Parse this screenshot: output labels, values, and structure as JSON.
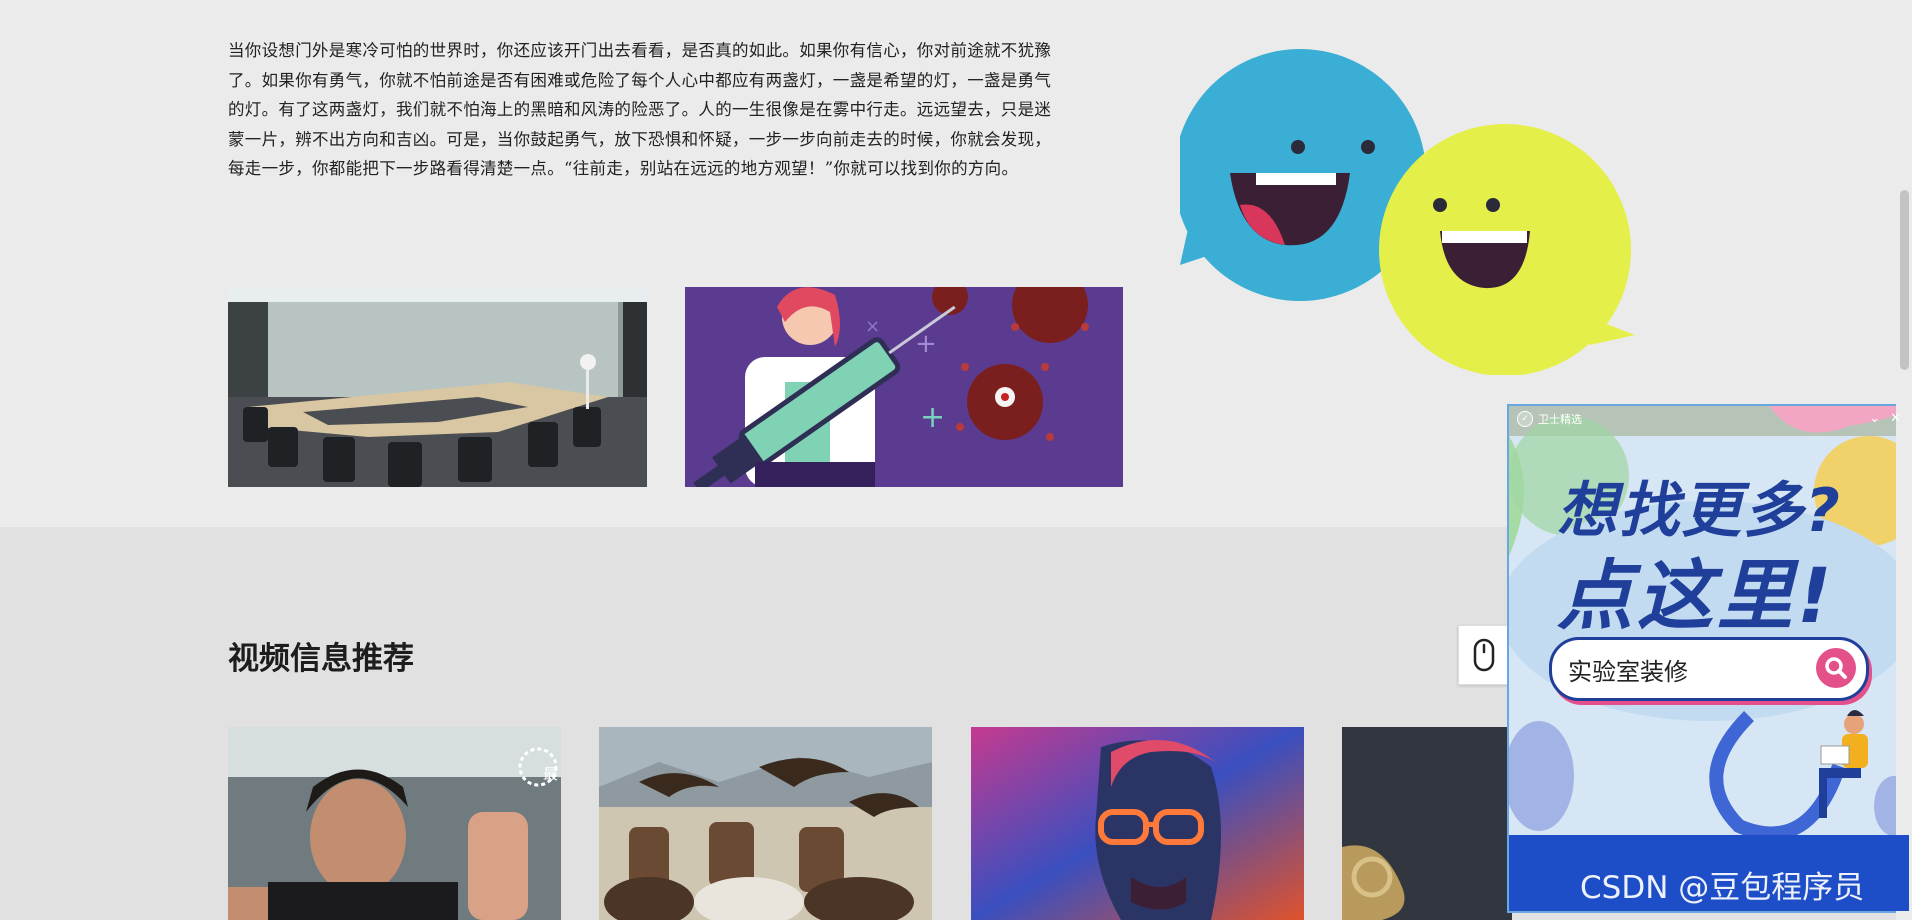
{
  "article": {
    "paragraph": "当你设想门外是寒冷可怕的世界时，你还应该开门出去看看，是否真的如此。如果你有信心，你对前途就不犹豫了。如果你有勇气，你就不怕前途是否有困难或危险了每个人心中都应有两盏灯，一盏是希望的灯，一盏是勇气的灯。有了这两盏灯，我们就不怕海上的黑暗和风涛的险恶了。人的一生很像是在雾中行走。远远望去，只是迷蒙一片，辨不出方向和吉凶。可是，当你鼓起勇气，放下恐惧和怀疑，一步一步向前走去的时候，你就会发现，每走一步，你都能把下一步路看得清楚一点。“往前走，别站在远远的地方观望！”你就可以找到你的方向。"
  },
  "video_section": {
    "title": "视频信息推荐",
    "card1_badge": "最"
  },
  "ad_popup": {
    "brand": "卫士精选",
    "headline_line1": "想找更多?",
    "headline_line2": "点这里!",
    "search_query": "实验室装修"
  },
  "watermark": "CSDN @豆包程序员",
  "colors": {
    "page_bg": "#ebebeb",
    "section_bg": "#e1e1e1",
    "bubble_blue": "#3aaed4",
    "bubble_yellow": "#e5ef4a",
    "ad_blue": "#1f3f9a",
    "ad_pink": "#e4508a"
  }
}
